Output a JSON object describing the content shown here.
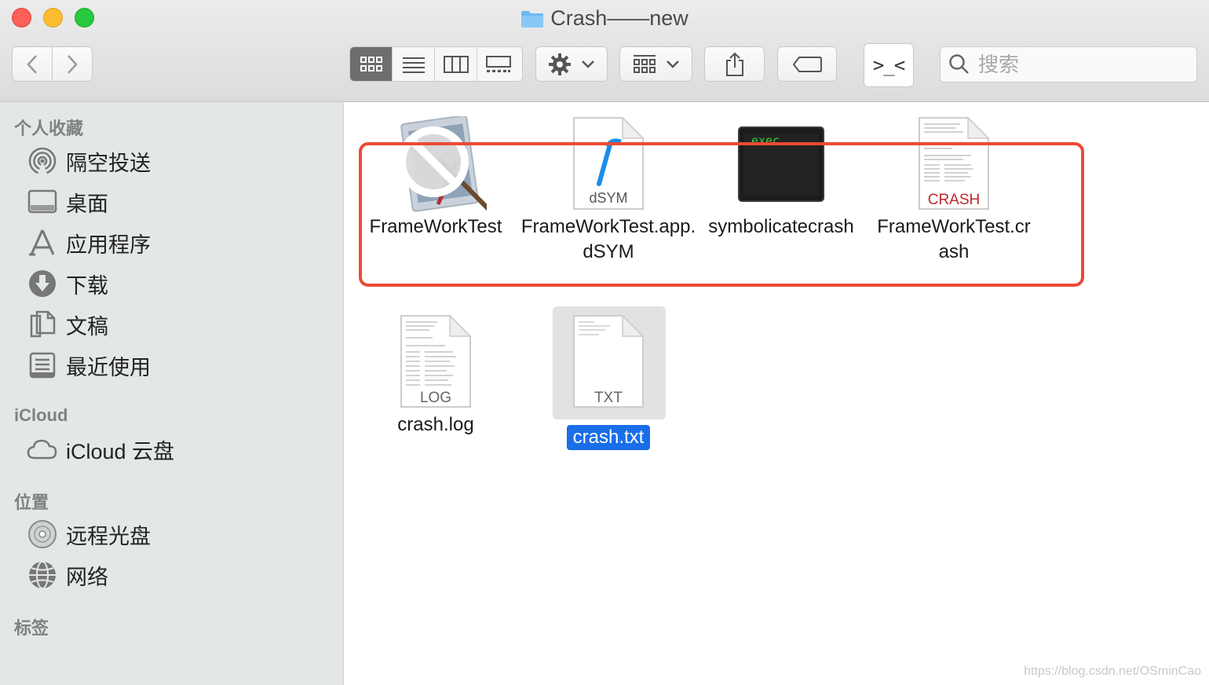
{
  "window": {
    "title": "Crash——new"
  },
  "toolbar": {
    "back_icon": "chevron-left-icon",
    "forward_icon": "chevron-right-icon",
    "view_modes": [
      "icon-view",
      "list-view",
      "column-view",
      "gallery-view"
    ],
    "active_view": "icon-view",
    "terminal_label": ">_<",
    "search_placeholder": "搜索"
  },
  "sidebar": {
    "favorites_header": "个人收藏",
    "favorites": [
      {
        "label": "隔空投送",
        "icon": "airdrop-icon"
      },
      {
        "label": "桌面",
        "icon": "desktop-icon"
      },
      {
        "label": "应用程序",
        "icon": "applications-icon"
      },
      {
        "label": "下载",
        "icon": "download-icon"
      },
      {
        "label": "文稿",
        "icon": "documents-icon"
      },
      {
        "label": "最近使用",
        "icon": "recents-icon"
      }
    ],
    "icloud_header": "iCloud",
    "icloud": [
      {
        "label": "iCloud 云盘",
        "icon": "cloud-icon"
      }
    ],
    "locations_header": "位置",
    "locations": [
      {
        "label": "远程光盘",
        "icon": "disc-icon"
      },
      {
        "label": "网络",
        "icon": "network-icon"
      }
    ],
    "tags_header": "标签"
  },
  "files": [
    {
      "name": "FrameWorkTest",
      "icon": "app-blocked-icon"
    },
    {
      "name": "FrameWorkTest.app.dSYM",
      "icon": "dsym-file-icon",
      "badge": "dSYM"
    },
    {
      "name": "symbolicatecrash",
      "icon": "exec-terminal-icon",
      "badge": "exec"
    },
    {
      "name": "FrameWorkTest.crash",
      "icon": "crash-file-icon",
      "badge": "CRASH"
    },
    {
      "name": "crash.log",
      "icon": "log-file-icon",
      "badge": "LOG"
    },
    {
      "name": "crash.txt",
      "icon": "txt-file-icon",
      "badge": "TXT",
      "selected": true
    }
  ],
  "watermark": "https://blog.csdn.net/OSminCao",
  "colors": {
    "highlight_box": "#ec4a36",
    "selection": "#1a6ee8",
    "sidebar_bg": "#e3e8e7"
  }
}
